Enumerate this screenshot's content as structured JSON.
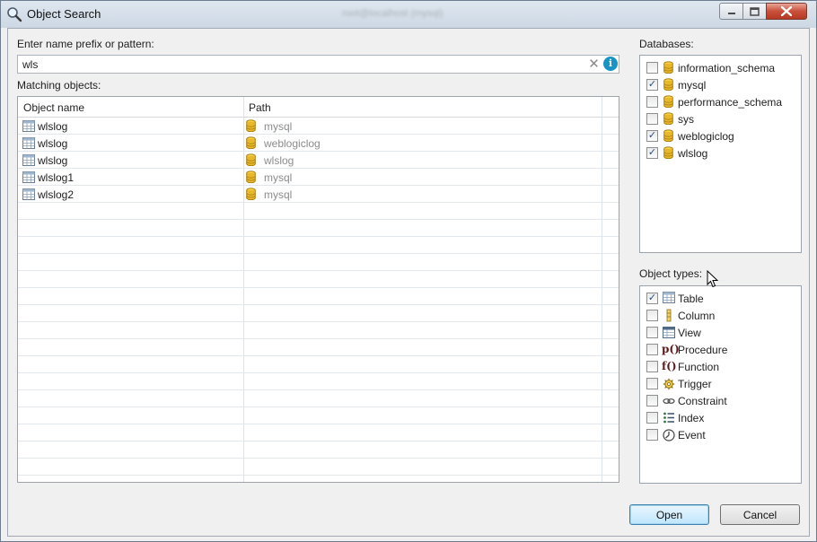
{
  "window": {
    "title": "Object Search",
    "ghost_title": "root@localhost (mysql)"
  },
  "search": {
    "label": "Enter name prefix or pattern:",
    "value": "wls",
    "clear_glyph": "✕",
    "info_glyph": "i"
  },
  "results": {
    "label": "Matching objects:",
    "columns": [
      "Object name",
      "Path"
    ],
    "rows": [
      {
        "name": "wlslog",
        "path": "mysql"
      },
      {
        "name": "wlslog",
        "path": "weblogiclog"
      },
      {
        "name": "wlslog",
        "path": "wlslog"
      },
      {
        "name": "wlslog1",
        "path": "mysql"
      },
      {
        "name": "wlslog2",
        "path": "mysql"
      }
    ]
  },
  "databases": {
    "label": "Databases:",
    "items": [
      {
        "label": "information_schema",
        "checked": false,
        "icon": "database-icon"
      },
      {
        "label": "mysql",
        "checked": true,
        "icon": "database-icon"
      },
      {
        "label": "performance_schema",
        "checked": false,
        "icon": "database-icon"
      },
      {
        "label": "sys",
        "checked": false,
        "icon": "database-icon"
      },
      {
        "label": "weblogiclog",
        "checked": true,
        "icon": "database-icon"
      },
      {
        "label": "wlslog",
        "checked": true,
        "icon": "database-icon"
      }
    ]
  },
  "object_types": {
    "label": "Object types:",
    "items": [
      {
        "label": "Table",
        "checked": true,
        "icon": "table-icon"
      },
      {
        "label": "Column",
        "checked": false,
        "icon": "column-icon"
      },
      {
        "label": "View",
        "checked": false,
        "icon": "view-icon"
      },
      {
        "label": "Procedure",
        "checked": false,
        "icon": "procedure-icon",
        "glyph": "p()"
      },
      {
        "label": "Function",
        "checked": false,
        "icon": "function-icon",
        "glyph": "f()"
      },
      {
        "label": "Trigger",
        "checked": false,
        "icon": "trigger-icon"
      },
      {
        "label": "Constraint",
        "checked": false,
        "icon": "constraint-icon"
      },
      {
        "label": "Index",
        "checked": false,
        "icon": "index-icon"
      },
      {
        "label": "Event",
        "checked": false,
        "icon": "event-icon"
      }
    ]
  },
  "buttons": {
    "open": "Open",
    "cancel": "Cancel"
  },
  "colors": {
    "accent": "#1793c6",
    "db_icon": "#e8b72a",
    "path_text": "#8c8c8c"
  }
}
